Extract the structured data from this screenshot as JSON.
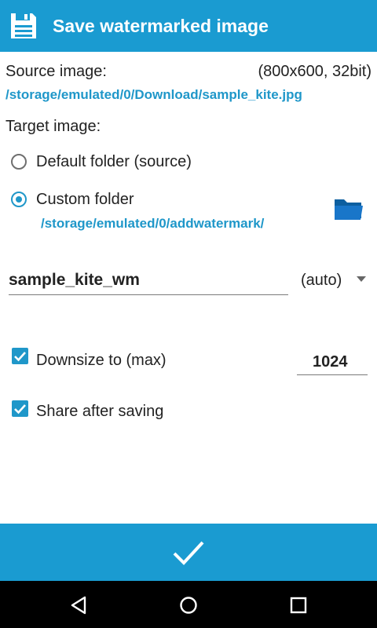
{
  "header": {
    "title": "Save watermarked image",
    "icon": "floppy-disk-icon"
  },
  "source": {
    "label": "Source image:",
    "info": "(800x600, 32bit)",
    "path": "/storage/emulated/0/Download/sample_kite.jpg"
  },
  "target": {
    "label": "Target image:",
    "default_option": "Default folder (source)",
    "custom_option": "Custom folder",
    "custom_path": "/storage/emulated/0/addwatermark/",
    "selected": "custom",
    "folder_icon": "folder-icon"
  },
  "filename": {
    "value": "sample_kite_wm",
    "format": "(auto)"
  },
  "downsize": {
    "label": "Downsize to (max)",
    "checked": true,
    "value": "1024"
  },
  "share": {
    "label": "Share after saving",
    "checked": true
  },
  "action": {
    "confirm_icon": "checkmark-icon"
  },
  "nav": {
    "back_icon": "back-icon",
    "home_icon": "home-icon",
    "recents_icon": "recents-icon"
  },
  "colors": {
    "accent": "#1a9bd1",
    "link": "#1f97c9"
  }
}
